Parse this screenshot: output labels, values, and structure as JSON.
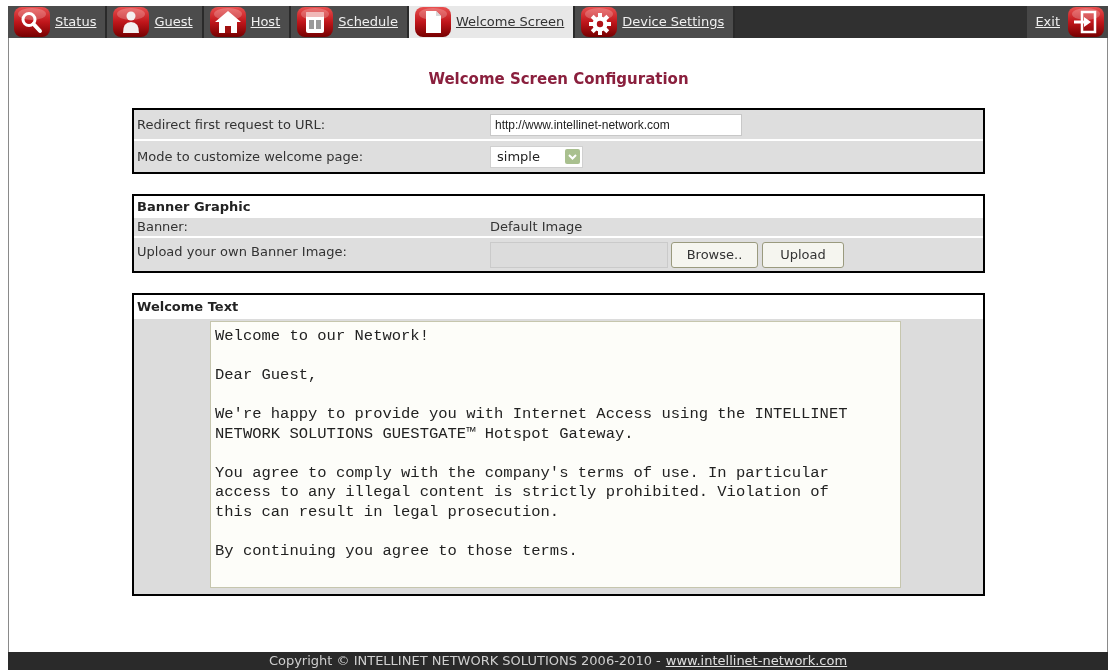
{
  "nav": {
    "tabs": [
      {
        "label": "Status",
        "selected": false
      },
      {
        "label": "Guest",
        "selected": false
      },
      {
        "label": "Host",
        "selected": false
      },
      {
        "label": "Schedule",
        "selected": false
      },
      {
        "label": "Welcome Screen",
        "selected": true
      },
      {
        "label": "Device Settings",
        "selected": false
      }
    ],
    "exit": {
      "label": "Exit"
    }
  },
  "title": "Welcome Screen Configuration",
  "redirect_section": {
    "rows": [
      {
        "kind": "input",
        "label": "Redirect first request to URL:",
        "value": "http://www.intellinet-network.com"
      },
      {
        "kind": "select",
        "label": "Mode to customize welcome page:",
        "value": "simple"
      }
    ]
  },
  "banner_section": {
    "heading": "Banner Graphic",
    "rows": [
      {
        "kind": "text",
        "label": "Banner:",
        "value": "Default Image"
      },
      {
        "kind": "upload",
        "label": "Upload your own Banner Image:",
        "buttons": [
          "Browse..",
          "Upload"
        ]
      }
    ]
  },
  "welcome_text_section": {
    "heading": "Welcome Text",
    "text": "Welcome to our Network!\n\nDear Guest,\n\nWe're happy to provide you with Internet Access using the INTELLINET\nNETWORK SOLUTIONS GUESTGATE™ Hotspot Gateway.\n\nYou agree to comply with the company's terms of use. In particular\naccess to any illegal content is strictly prohibited. Violation of\nthis can result in legal prosecution.\n\nBy continuing you agree to those terms."
  },
  "footer": {
    "copyright": "Copyright © INTELLINET NETWORK SOLUTIONS 2006-2010 -",
    "link": "www.intellinet-network.com"
  }
}
